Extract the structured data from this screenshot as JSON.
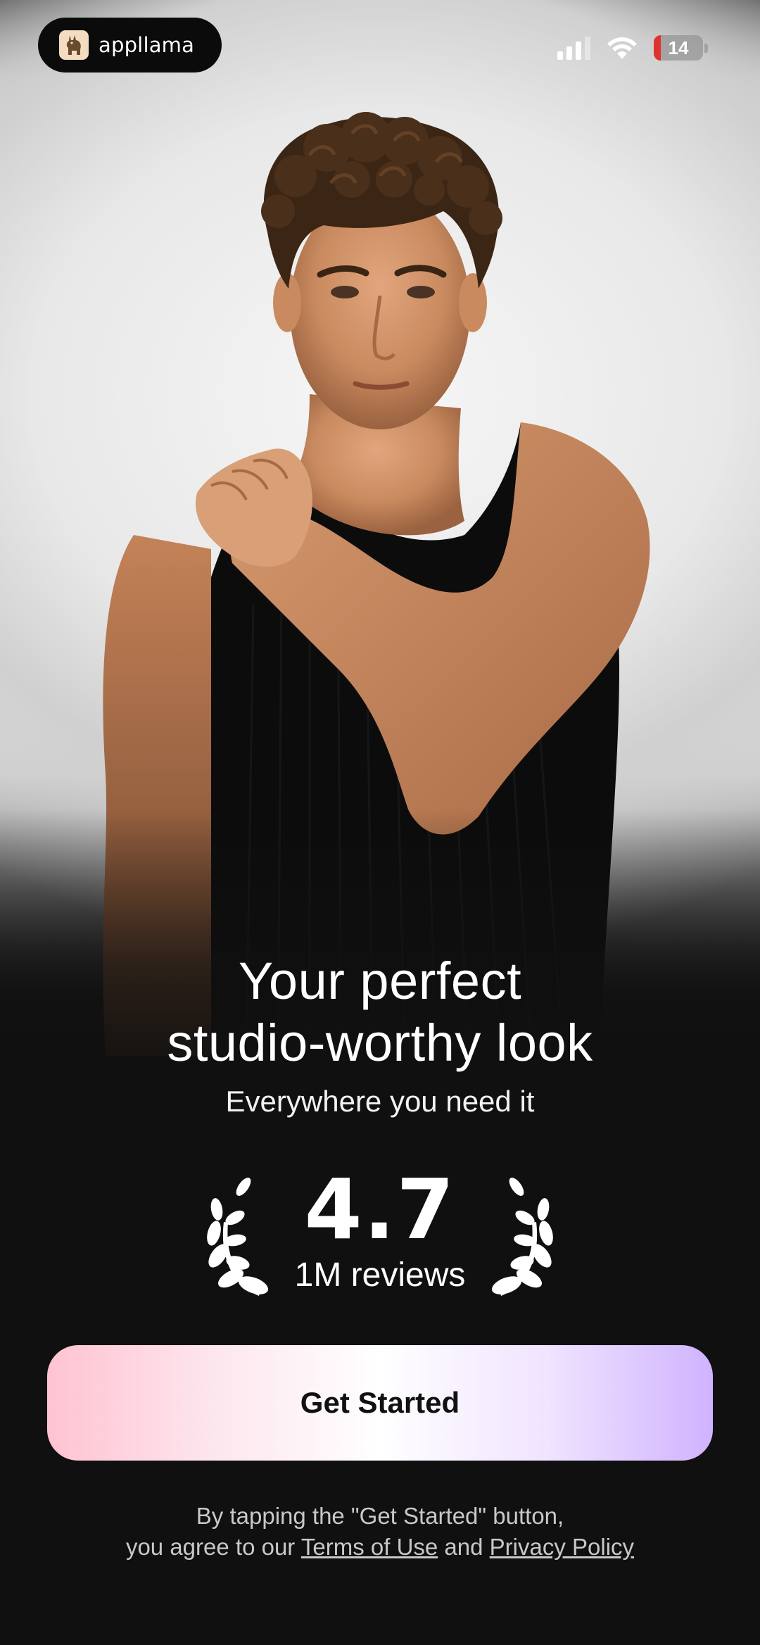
{
  "app": {
    "brand_name": "appllama",
    "brand_logo_icon": "llama-icon"
  },
  "status_bar": {
    "signal_icon": "cellular-signal-icon",
    "wifi_icon": "wifi-icon",
    "battery_level": "14",
    "battery_low_color": "#e0322e"
  },
  "hero": {
    "image": "portrait-photo",
    "headline_line1": "Your perfect",
    "headline_line2": "studio-worthy look",
    "subheadline": "Everywhere you need it"
  },
  "rating": {
    "value": "4.7",
    "reviews": "1M reviews",
    "laurel_icon": "laurel-wreath-icon"
  },
  "cta": {
    "label": "Get Started",
    "gradient_start": "#ffc3d1",
    "gradient_end": "#d0b3ff"
  },
  "legal": {
    "line1": "By tapping the \"Get Started\" button,",
    "line2_prefix": "you agree to our",
    "terms_link": "Terms of Use",
    "connector": "and",
    "privacy_link": "Privacy Policy"
  }
}
